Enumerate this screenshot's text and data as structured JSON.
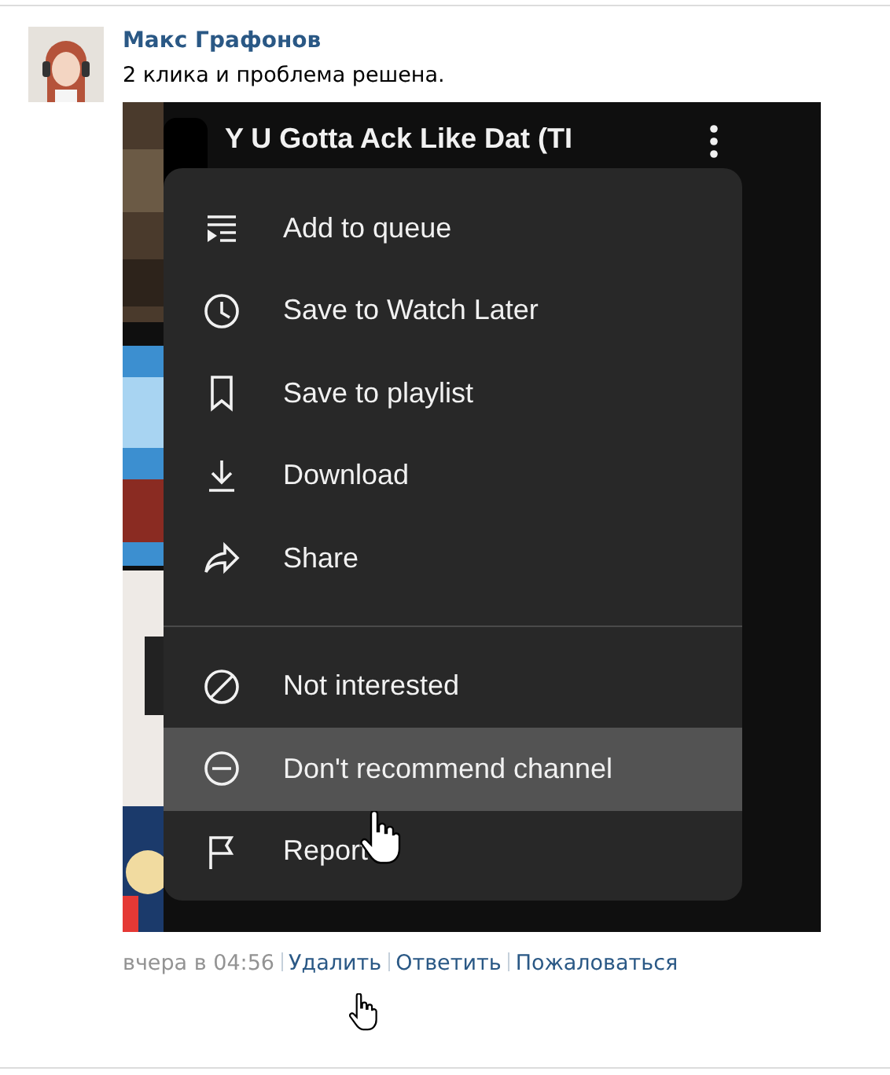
{
  "post": {
    "author": "Макс Графонов",
    "text": "2 клика и проблема решена."
  },
  "screenshot": {
    "video_title": "Y U Gotta Ack Like Dat (TI",
    "menu_groups": [
      [
        {
          "label": "Add to queue",
          "hovered": false
        },
        {
          "label": "Save to Watch Later",
          "hovered": false
        },
        {
          "label": "Save to playlist",
          "hovered": false
        },
        {
          "label": "Download",
          "hovered": false
        },
        {
          "label": "Share",
          "hovered": false
        }
      ],
      [
        {
          "label": "Not interested",
          "hovered": false
        },
        {
          "label": "Don't recommend channel",
          "hovered": true
        },
        {
          "label": "Report",
          "hovered": false
        }
      ]
    ]
  },
  "footer": {
    "time": "вчера в 04:56",
    "actions": [
      "Удалить",
      "Ответить",
      "Пожаловаться"
    ]
  }
}
